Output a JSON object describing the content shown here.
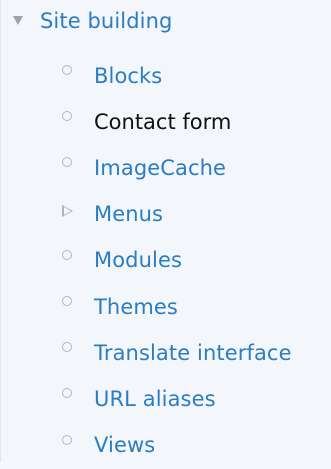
{
  "section": {
    "title": "Site building"
  },
  "menu": {
    "items": [
      {
        "label": "Blocks",
        "type": "link"
      },
      {
        "label": "Contact form",
        "type": "active"
      },
      {
        "label": "ImageCache",
        "type": "link"
      },
      {
        "label": "Menus",
        "type": "link",
        "expandable": true
      },
      {
        "label": "Modules",
        "type": "link"
      },
      {
        "label": "Themes",
        "type": "link"
      },
      {
        "label": "Translate interface",
        "type": "link"
      },
      {
        "label": "URL aliases",
        "type": "link"
      },
      {
        "label": "Views",
        "type": "link"
      }
    ]
  },
  "colors": {
    "link": "#2a7dc3",
    "active_text": "#111111",
    "background": "#f3f6fa",
    "bullet": "#b3b8bd"
  },
  "icons": {
    "section_toggle": "collapse-triangle-down-icon",
    "bullet": "bullet-circle-icon",
    "submenu": "expand-triangle-right-icon"
  }
}
